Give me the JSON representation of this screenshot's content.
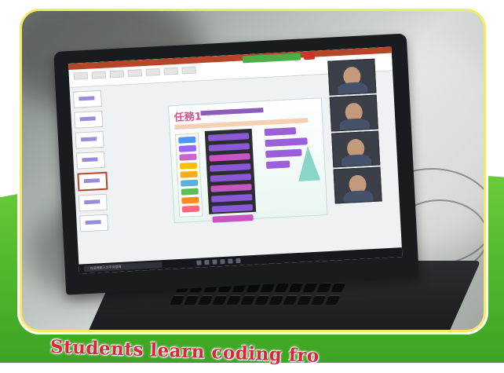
{
  "caption": "Students learn coding fro",
  "screen": {
    "slide_heading": "任務1",
    "teams_indicator": "",
    "taskbar_search": "在這裡輸入文字來搜尋"
  },
  "colors": {
    "frame": "#f7ea63",
    "background_green": "#4fb72c",
    "caption_text": "#d7263d",
    "slide_accent": "#e24b8b"
  },
  "icons": [
    "record-icon",
    "windows-start-icon"
  ]
}
